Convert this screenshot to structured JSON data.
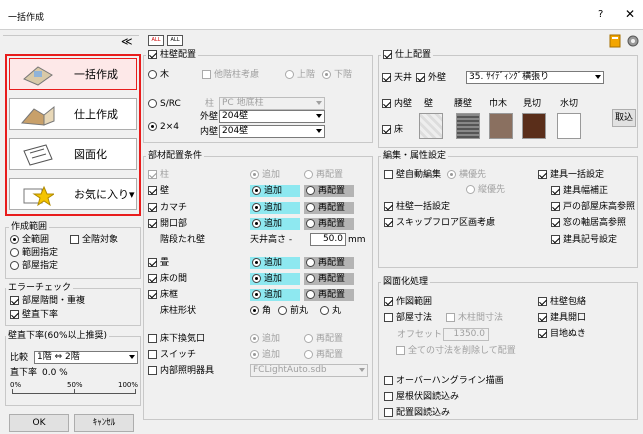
{
  "window": {
    "title": "一括作成",
    "help": "?",
    "close": "✕"
  },
  "left": {
    "collapse": "≪",
    "buttons": [
      "一括作成",
      "仕上作成",
      "図面化",
      "お気に入り▾"
    ],
    "range": {
      "title": "作成範囲",
      "all": "全範囲",
      "all_floors": "全階対象",
      "specified": "範囲指定",
      "room": "部屋指定"
    },
    "error": {
      "title": "エラーチェック",
      "stairs": "部屋階間・重複",
      "straight": "壁直下率"
    },
    "ratio": {
      "title": "壁直下率(60%以上推奨)",
      "compare": "比較",
      "floors": "1階 ⇔ 2階",
      "label": "直下率",
      "value": "0.0 %",
      "ticks": [
        "0%",
        "50%",
        "100%"
      ]
    },
    "ok": "OK",
    "cancel": "ｷｬﾝｾﾙ"
  },
  "top_icons": {
    "all_on": "ALL",
    "all_off": "ALL"
  },
  "pillar": {
    "title": "柱壁配置",
    "wood": "木",
    "other_floor": "他階柱考慮",
    "upper": "上階",
    "lower": "下階",
    "src": "S/RC",
    "pillar_label": "柱",
    "pillar_value": "PC 地底柱",
    "two_by": "2×4",
    "outer_label": "外壁",
    "outer_value": "204壁",
    "inner_label": "内壁",
    "inner_value": "204壁"
  },
  "finish": {
    "title": "仕上配置",
    "ceiling": "天井",
    "exterior": "外壁",
    "exterior_value": "35. ｻｲﾃﾞｨﾝｸﾞ横張り",
    "interior": "内壁",
    "floor": "床",
    "cols": [
      "壁",
      "腰壁",
      "巾木",
      "見切",
      "水切"
    ],
    "fetch": "取込"
  },
  "member": {
    "title": "部材配置条件",
    "add": "追加",
    "replace": "再配置",
    "items": [
      "柱",
      "壁",
      "カマチ",
      "開口部"
    ],
    "stair_label": "階段たれ壁",
    "ceiling_h": "天井高さ -",
    "ceiling_v": "50.0",
    "unit": "mm",
    "items2": [
      "畳",
      "床の間",
      "床框"
    ],
    "frame_shape": "床柱形状",
    "shapes": [
      "角",
      "前丸",
      "丸"
    ],
    "items3": [
      "床下換気口",
      "スイッチ",
      "内部照明器具"
    ],
    "light_value": "FCLightAuto.sdb"
  },
  "edit": {
    "title": "編集・属性設定",
    "auto": "壁自動編集",
    "prio_h": "横優先",
    "prio_v": "縦優先",
    "pillar_set": "柱壁一括設定",
    "skip": "スキップフロア区画考慮",
    "right": [
      "建具一括設定",
      "建具幅補正",
      "戸の部屋床高参照",
      "窓の軸居高参照",
      "建具記号設定"
    ]
  },
  "drawing": {
    "title": "図面化処理",
    "range": "作図範囲",
    "room_dim": "部屋寸法",
    "pillar_dim": "木柱間寸法",
    "offset_label": "オフセット",
    "offset_value": "1350.0",
    "reset": "全ての寸法を削除して配置",
    "right": [
      "柱壁包絡",
      "建具開口",
      "目地ぬき"
    ],
    "bottom": [
      "オーバーハングライン描画",
      "屋根伏図読込み",
      "配置図読込み"
    ]
  },
  "colors": {
    "accent": "#e81c1c",
    "cyan": "#8ee8f0",
    "gray": "#b4b4b4"
  }
}
